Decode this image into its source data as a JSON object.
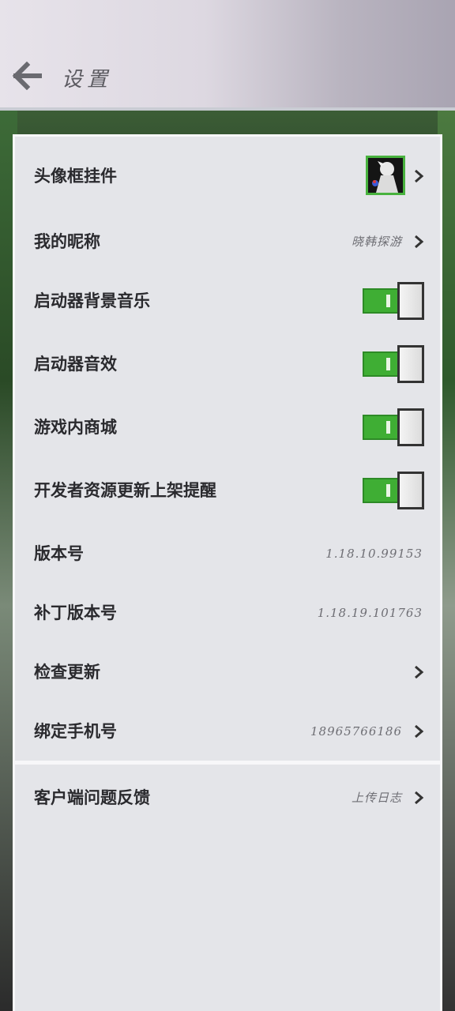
{
  "header": {
    "title": "设置"
  },
  "settings": [
    {
      "label": "头像框挂件",
      "type": "avatar"
    },
    {
      "label": "我的昵称",
      "value": "晓韩探游",
      "type": "link"
    },
    {
      "label": "启动器背景音乐",
      "type": "toggle",
      "on": true
    },
    {
      "label": "启动器音效",
      "type": "toggle",
      "on": true
    },
    {
      "label": "游戏内商城",
      "type": "toggle",
      "on": true
    },
    {
      "label": "开发者资源更新上架提醒",
      "type": "toggle",
      "on": true
    },
    {
      "label": "版本号",
      "value": "1.18.10.99153",
      "type": "text"
    },
    {
      "label": "补丁版本号",
      "value": "1.18.19.101763",
      "type": "text"
    },
    {
      "label": "检查更新",
      "type": "link"
    },
    {
      "label": "绑定手机号",
      "value": "18965766186",
      "type": "link"
    }
  ],
  "feedback": {
    "label": "客户端问题反馈",
    "value": "上传日志"
  },
  "colors": {
    "toggle_on": "#3fae34",
    "panel": "#e4e5e9",
    "avatar_border": "#48b23e"
  },
  "icons": {
    "back": "arrow-left-icon",
    "chevron": "chevron-right-icon"
  }
}
